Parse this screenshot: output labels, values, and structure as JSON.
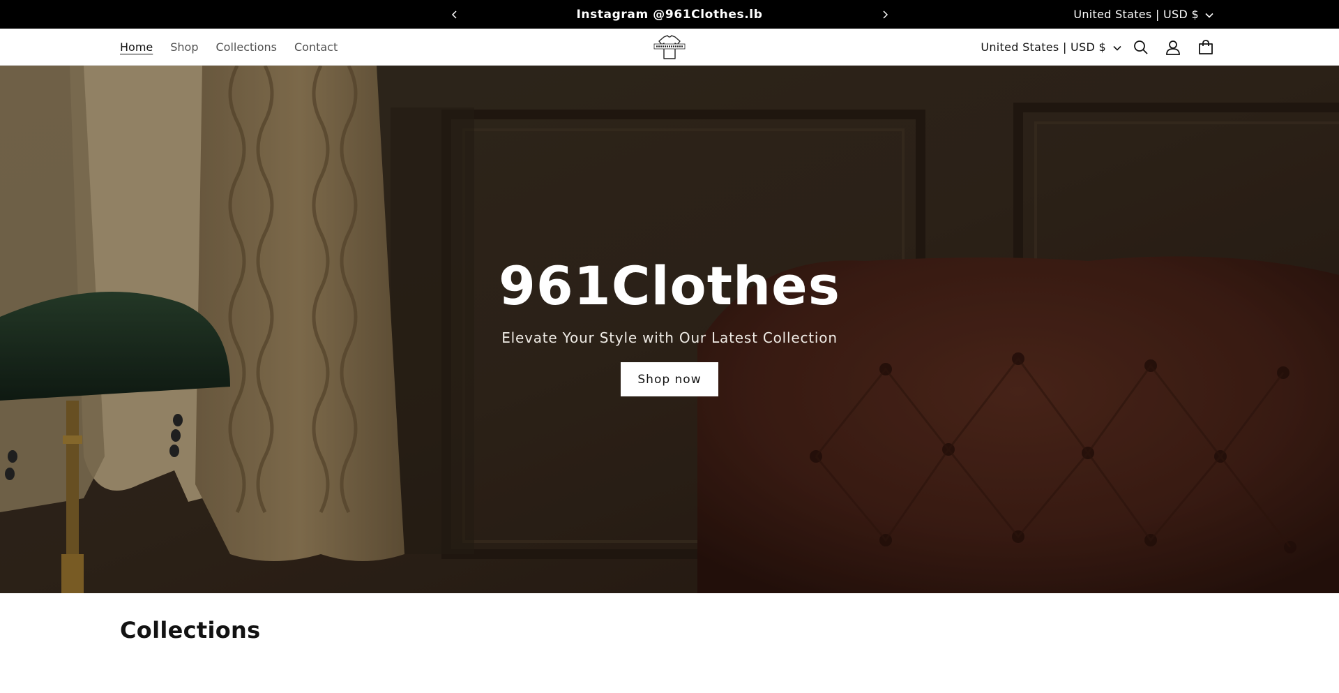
{
  "announcement": {
    "message": "Instagram @961Clothes.lb",
    "locale": "United States | USD $",
    "icons": {
      "prev": "chevron-left-icon",
      "next": "chevron-right-icon",
      "dropdown": "chevron-down-icon"
    }
  },
  "header": {
    "nav": [
      {
        "label": "Home",
        "active": true
      },
      {
        "label": "Shop",
        "active": false
      },
      {
        "label": "Collections",
        "active": false
      },
      {
        "label": "Contact",
        "active": false
      }
    ],
    "locale": "United States | USD $",
    "icons": {
      "search": "search-icon",
      "account": "account-icon",
      "cart": "cart-icon",
      "logo": "tshirt-logo-icon"
    }
  },
  "hero": {
    "title": "961Clothes",
    "subtitle": "Elevate Your Style with Our Latest Collection",
    "button": "Shop now"
  },
  "collections": {
    "heading": "Collections"
  },
  "colors": {
    "announcement_bg": "#000000",
    "text": "#121212",
    "hero_overlay_text": "#ffffff"
  }
}
